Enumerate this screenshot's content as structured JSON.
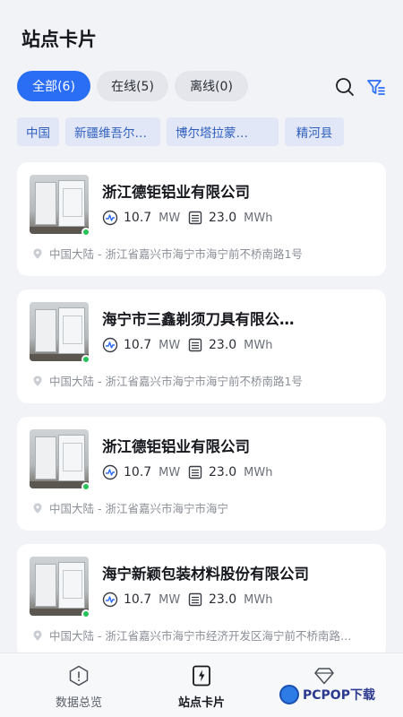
{
  "page": {
    "title": "站点卡片"
  },
  "tabs": [
    {
      "label": "全部(6)",
      "active": true
    },
    {
      "label": "在线(5)",
      "active": false
    },
    {
      "label": "离线(0)",
      "active": false
    }
  ],
  "toolbar": {
    "search_icon": "search-icon",
    "filter_icon": "filter-icon"
  },
  "region_chips": [
    "中国",
    "新疆维吾尔…",
    "博尔塔拉蒙…",
    "精河县"
  ],
  "stations": [
    {
      "name": "浙江德钜铝业有限公司",
      "power_value": "10.7",
      "power_unit": "MW",
      "energy_value": "23.0",
      "energy_unit": "MWh",
      "address": "中国大陆 - 浙江省嘉兴市海宁市海宁前不桥南路1号",
      "status": "online"
    },
    {
      "name": "海宁市三鑫剃须刀具有限公…",
      "power_value": "10.7",
      "power_unit": "MW",
      "energy_value": "23.0",
      "energy_unit": "MWh",
      "address": "中国大陆 - 浙江省嘉兴市海宁市海宁前不桥南路1号",
      "status": "online"
    },
    {
      "name": "浙江德钜铝业有限公司",
      "power_value": "10.7",
      "power_unit": "MW",
      "energy_value": "23.0",
      "energy_unit": "MWh",
      "address": "中国大陆 - 浙江省嘉兴市海宁市海宁",
      "status": "online"
    },
    {
      "name": "海宁新颖包装材料股份有限公司",
      "power_value": "10.7",
      "power_unit": "MW",
      "energy_value": "23.0",
      "energy_unit": "MWh",
      "address": "中国大陆 - 浙江省嘉兴市海宁市经济开发区海宁前不桥南路…",
      "status": "online"
    }
  ],
  "bottom_nav": [
    {
      "label": "数据总览",
      "icon": "info-icon",
      "active": false
    },
    {
      "label": "站点卡片",
      "icon": "lightning-card-icon",
      "active": true
    },
    {
      "label": "",
      "icon": "diamond-icon",
      "active": false
    }
  ],
  "watermark": {
    "text": "PCPOP下载"
  },
  "colors": {
    "accent": "#2b6ef6",
    "online": "#27c25a",
    "chip_text": "#2f5fbf",
    "chip_bg": "#e1e7f6"
  }
}
